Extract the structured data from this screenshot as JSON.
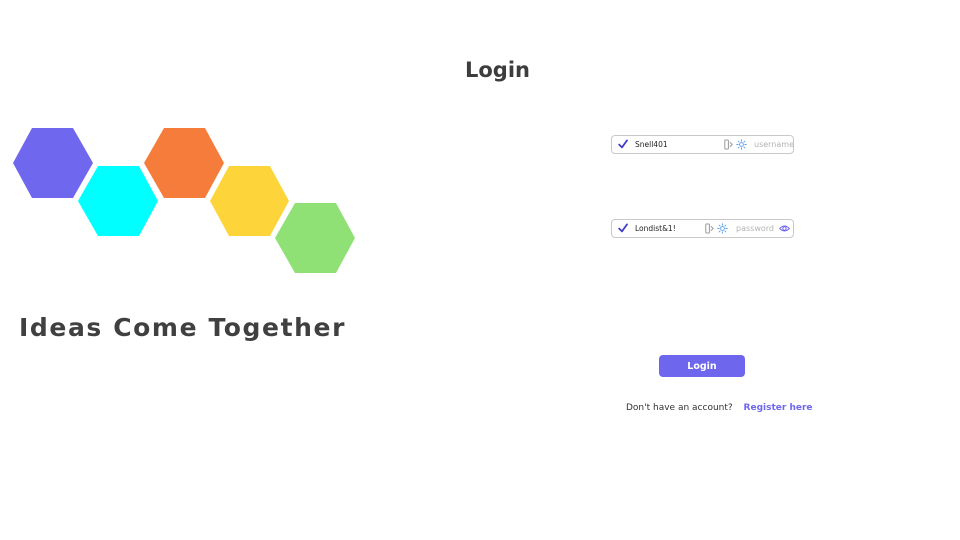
{
  "page": {
    "title": "Login"
  },
  "brand": {
    "tagline": "Ideas Come Together",
    "hexagon_colors": [
      "#6f67ee",
      "#00ffff",
      "#f67c3c",
      "#fdd53a",
      "#8fe176"
    ]
  },
  "form": {
    "username": {
      "value": "Snell401",
      "placeholder": "username",
      "type": "text"
    },
    "password": {
      "value": "Londist&1!",
      "placeholder": "password",
      "type": "text"
    },
    "login_button_label": "Login",
    "register_prompt": "Don't have an account?",
    "register_link_label": "Register here"
  },
  "icons": {
    "field_check": "check-icon",
    "password_manager_key": "key-icon",
    "autofill_sparkle": "sparkle-icon",
    "show_password": "eye-icon"
  },
  "colors": {
    "accent": "#6e67ee",
    "title_text": "#3d3d3d",
    "field_border": "#c9c9c9",
    "placeholder": "#b3b3b3"
  }
}
